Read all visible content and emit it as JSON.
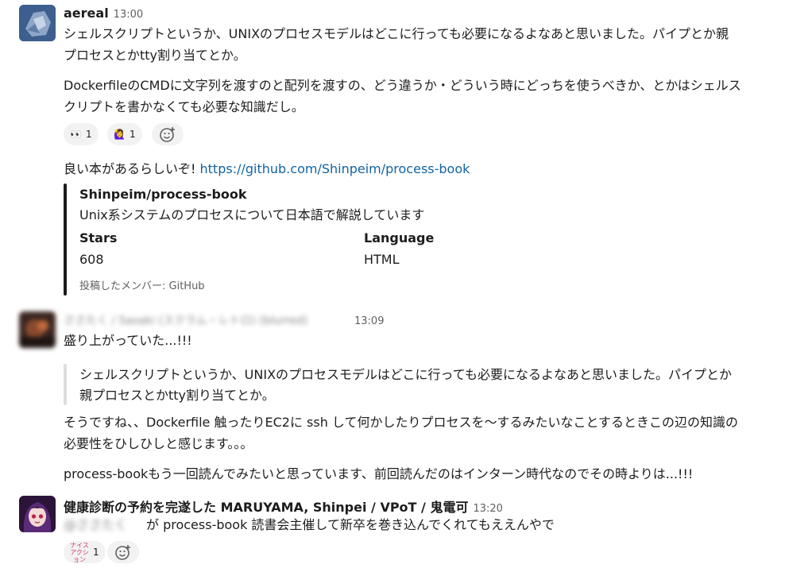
{
  "messages": [
    {
      "author": "aereal",
      "time": "13:00",
      "lines": [
        "シェルスクリプトというか、UNIXのプロセスモデルはどこに行っても必要になるよなあと思いました。パイプとか親",
        "プロセスとかtty割り当てとか。",
        "DockerfileのCMDに文字列を渡すのと配列を渡すの、どう違うか・どういう時にどっちを使うべきか、とかはシェルス",
        "クリプトを書かなくても必要な知識だし。"
      ],
      "reactions": [
        {
          "emoji": "👀",
          "count": "1"
        },
        {
          "emoji": "🙋‍♀️",
          "count": "1"
        }
      ],
      "followup_text": "良い本があるらしいぞ! ",
      "followup_link": "https://github.com/Shinpeim/process-book",
      "attachment": {
        "title": "Shinpeim/process-book",
        "description": "Unix系システムのプロセスについて日本語で解説しています",
        "field1_label": "Stars",
        "field1_value": "608",
        "field2_label": "Language",
        "field2_value": "HTML",
        "footer": "投稿したメンバー: GitHub"
      }
    },
    {
      "author": "ささたく / Sasaki (スクラム・レトロ) (blurred)",
      "time": "13:09",
      "lines": [
        "盛り上がっていた...!!!"
      ],
      "quote": [
        "シェルスクリプトというか、UNIXのプロセスモデルはどこに行っても必要になるよなあと思いました。パイプとか",
        "親プロセスとかtty割り当てとか。"
      ],
      "after_quote": [
        "そうですね、、Dockerfile 触ったりEC2に ssh して何かしたりプロセスを〜するみたいなことするときこの辺の知識の",
        "必要性をひしひしと感じます。。。",
        "process-bookもう一回読んでみたいと思っています、前回読んだのはインターン時代なのでその時よりは...!!!"
      ]
    },
    {
      "author": "健康診断の予約を完遂した MARUYAMA, Shinpei / VPoT / 鬼電可",
      "time": "13:20",
      "mention": "@ささたく",
      "text": "が process-book 読書会主催して新卒を巻き込んでくれてもええんやで",
      "reactions": [
        {
          "emoji": "ナイス アクション",
          "count": "1"
        }
      ]
    }
  ],
  "colors": {
    "text": "#1d1c1d",
    "muted": "#616061",
    "link": "#1264a3",
    "reaction_bg": "#f2f2f2"
  }
}
